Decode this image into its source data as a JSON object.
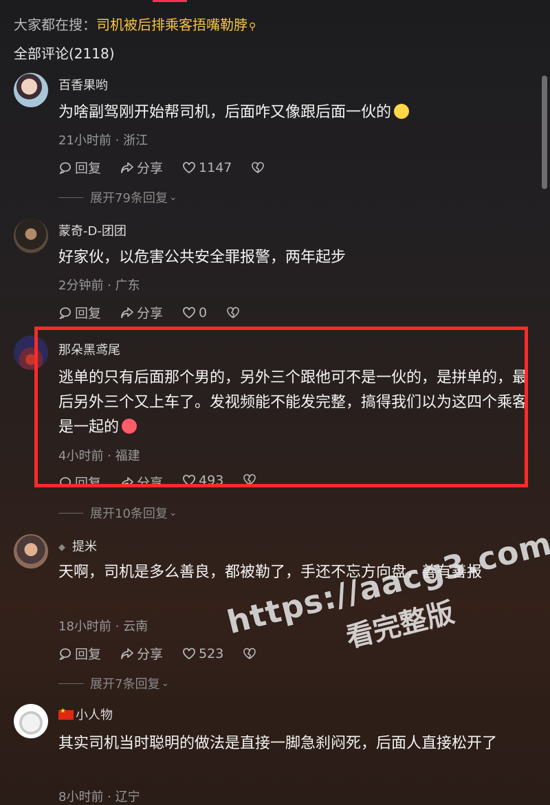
{
  "header": {
    "search_prefix": "大家都在搜：",
    "search_keyword": "司机被后排乘客捂嘴勒脖",
    "all_comments": "全部评论(2118)"
  },
  "comments": [
    {
      "user": "百香果哟",
      "text": "为啥副驾刚开始帮司机，后面咋又像跟后面一伙的",
      "emoji": "laughing-crying-emoji",
      "meta": "21小时前 · 浙江",
      "reply": "回复",
      "share": "分享",
      "likes": "1147",
      "expand": "展开79条回复"
    },
    {
      "user": "蒙奇-D-团团",
      "text": "好家伙，以危害公共安全罪报警，两年起步",
      "meta": "2分钟前 · 广东",
      "reply": "回复",
      "share": "分享",
      "likes": "0"
    },
    {
      "user": "那朵黑鸢尾",
      "text": "逃单的只有后面那个男的，另外三个跟他可不是一伙的，是拼单的，最后另外三个又上车了。发视频能不能发完整，搞得我们以为这四个乘客是一起的",
      "emoji": "angry-emoji",
      "meta": "4小时前 · 福建",
      "reply": "回复",
      "share": "分享",
      "likes": "493",
      "expand": "展开10条回复"
    },
    {
      "user": "提米",
      "text": "天啊，司机是多么善良，都被勒了，手还不忘方向盘，善有善报",
      "meta": "18小时前 · 云南",
      "reply": "回复",
      "share": "分享",
      "likes": "523",
      "expand": "展开7条回复"
    },
    {
      "user": "小人物",
      "text": "其实司机当时聪明的做法是直接一脚急刹闷死，后面人直接松开了",
      "meta": "8小时前 · 辽宁"
    }
  ],
  "watermark": {
    "url": "https://aacg3.com",
    "sub": "看完整版"
  },
  "colors": {
    "keyword": "#f5c542",
    "highlight": "#ff2a2a",
    "accent": "#ff2c55"
  }
}
